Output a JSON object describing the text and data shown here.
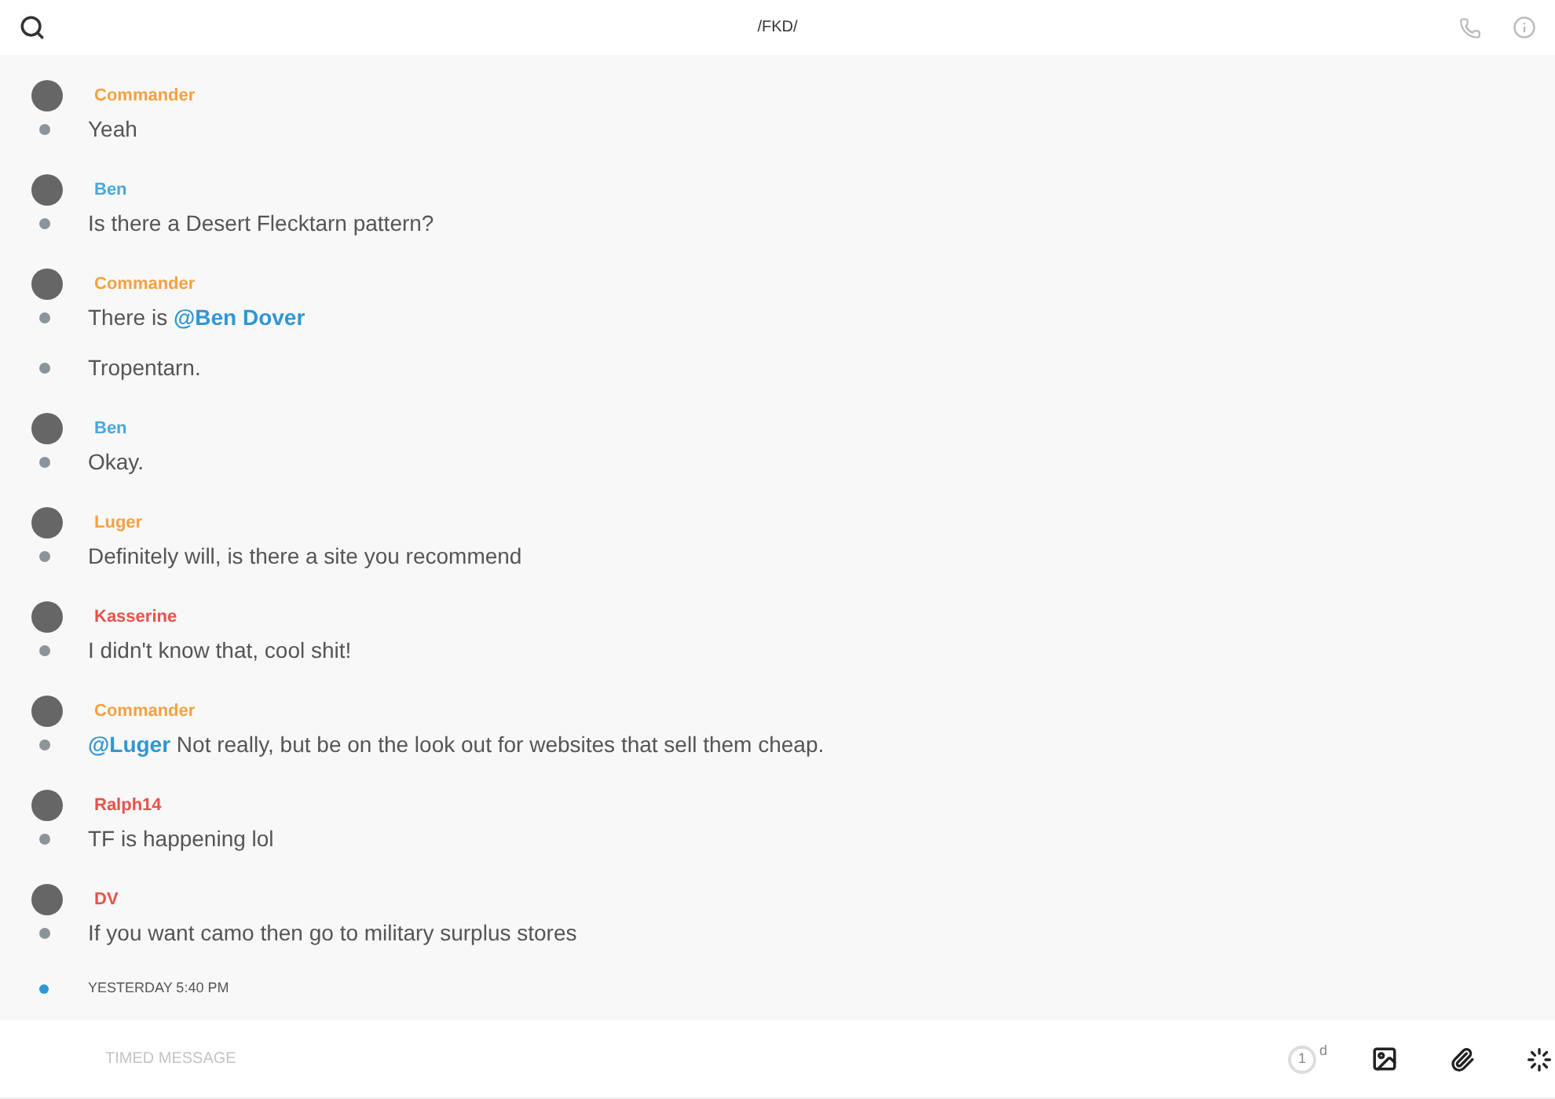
{
  "header": {
    "title": "/FKD/"
  },
  "messages": [
    {
      "author": "Commander",
      "color": "#f5a142",
      "lines": [
        [
          {
            "kind": "text",
            "text": "Yeah"
          }
        ]
      ]
    },
    {
      "author": "Ben",
      "color": "#4aa8dc",
      "lines": [
        [
          {
            "kind": "text",
            "text": "Is there a Desert Flecktarn pattern?"
          }
        ]
      ]
    },
    {
      "author": "Commander",
      "color": "#f5a142",
      "lines": [
        [
          {
            "kind": "text",
            "text": "There is "
          },
          {
            "kind": "mention",
            "text": "@Ben Dover"
          }
        ],
        [
          {
            "kind": "text",
            "text": "Tropentarn."
          }
        ]
      ]
    },
    {
      "author": "Ben",
      "color": "#4aa8dc",
      "lines": [
        [
          {
            "kind": "text",
            "text": "Okay."
          }
        ]
      ]
    },
    {
      "author": "Luger",
      "color": "#f5a142",
      "lines": [
        [
          {
            "kind": "text",
            "text": "Definitely will, is there a site you recommend"
          }
        ]
      ]
    },
    {
      "author": "Kasserine",
      "color": "#e8514a",
      "lines": [
        [
          {
            "kind": "text",
            "text": "I didn't know that, cool shit!"
          }
        ]
      ]
    },
    {
      "author": "Commander",
      "color": "#f5a142",
      "lines": [
        [
          {
            "kind": "mention",
            "text": "@Luger"
          },
          {
            "kind": "text",
            "text": " Not really, but be on the look out for websites that sell them cheap."
          }
        ]
      ]
    },
    {
      "author": "Ralph14",
      "color": "#e8514a",
      "lines": [
        [
          {
            "kind": "text",
            "text": "TF is happening lol"
          }
        ]
      ]
    },
    {
      "author": "DV",
      "color": "#e8514a",
      "lines": [
        [
          {
            "kind": "text",
            "text": "If you want camo then go to military surplus stores"
          }
        ]
      ]
    }
  ],
  "divider": {
    "label": "YESTERDAY 5:40 PM"
  },
  "composer": {
    "placeholder": "TIMED MESSAGE",
    "timer": "1",
    "timer_unit": "d"
  }
}
